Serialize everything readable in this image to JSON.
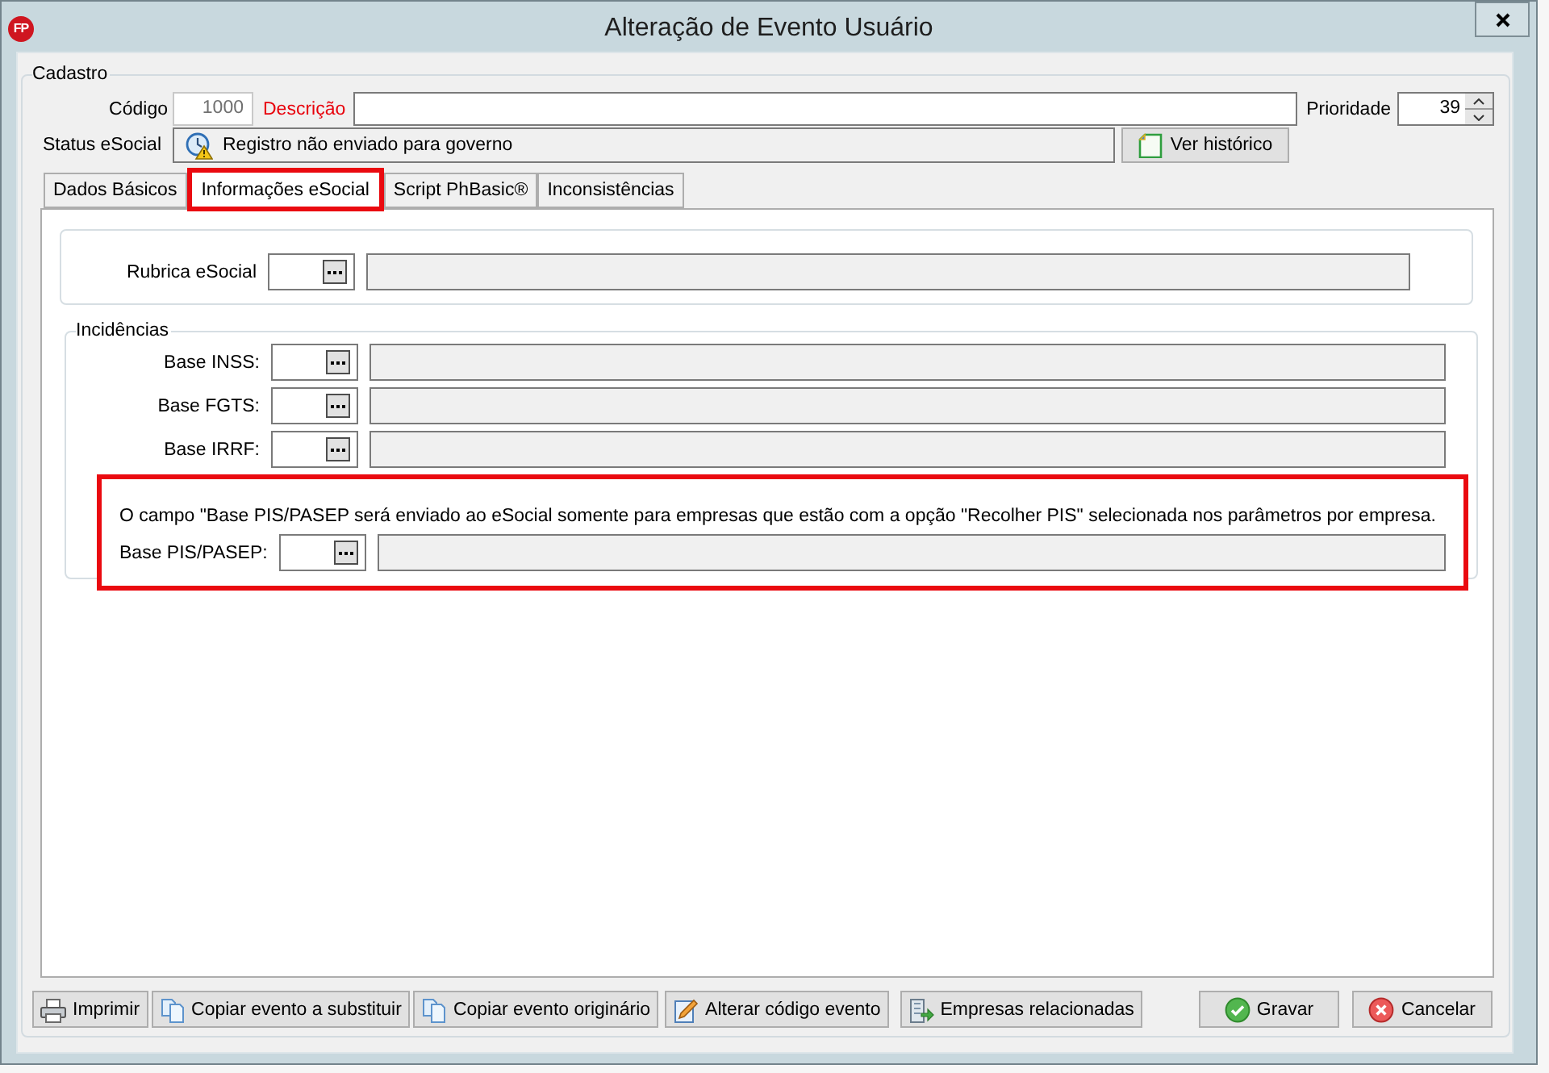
{
  "window": {
    "logo_text": "FP",
    "title": "Alteração de Evento Usuário"
  },
  "cadastro": {
    "title": "Cadastro",
    "codigo": {
      "label": "Código",
      "value": "1000",
      "readonly": true
    },
    "descricao": {
      "label": "Descrição",
      "required": true
    },
    "prioridade": {
      "label": "Prioridade",
      "value": "39"
    },
    "status": {
      "label": "Status eSocial",
      "text": "Registro não enviado para governo"
    },
    "history_button": {
      "label": "Ver histórico"
    }
  },
  "tabs": [
    {
      "label": "Dados Básicos",
      "selected": false,
      "highlighted": false
    },
    {
      "label": "Informações eSocial",
      "selected": true,
      "highlighted": true
    },
    {
      "label": "Script PhBasic®",
      "selected": false,
      "highlighted": false
    },
    {
      "label": "Inconsistências",
      "selected": false,
      "highlighted": false
    }
  ],
  "rubrica": {
    "label": "Rubrica eSocial"
  },
  "incidencias": {
    "title": "Incidências",
    "rows": [
      {
        "label": "Base INSS:"
      },
      {
        "label": "Base FGTS:"
      },
      {
        "label": "Base IRRF:"
      }
    ],
    "pis": {
      "highlighted": true,
      "note": "O campo \"Base PIS/PASEP será enviado ao eSocial somente para empresas que estão com a opção \"Recolher PIS\" selecionada nos parâmetros por empresa.",
      "label": "Base PIS/PASEP:"
    }
  },
  "footer": {
    "left_buttons": [
      {
        "kind": "print",
        "label": "Imprimir"
      },
      {
        "kind": "copy",
        "label": "Copiar evento a substituir"
      },
      {
        "kind": "copy",
        "label": "Copiar evento originário"
      },
      {
        "kind": "edit",
        "label": "Alterar código evento"
      },
      {
        "kind": "companies",
        "label": "Empresas relacionadas"
      }
    ],
    "right_buttons": [
      {
        "kind": "save",
        "label": "Gravar"
      },
      {
        "kind": "cancel",
        "label": "Cancelar"
      }
    ]
  }
}
